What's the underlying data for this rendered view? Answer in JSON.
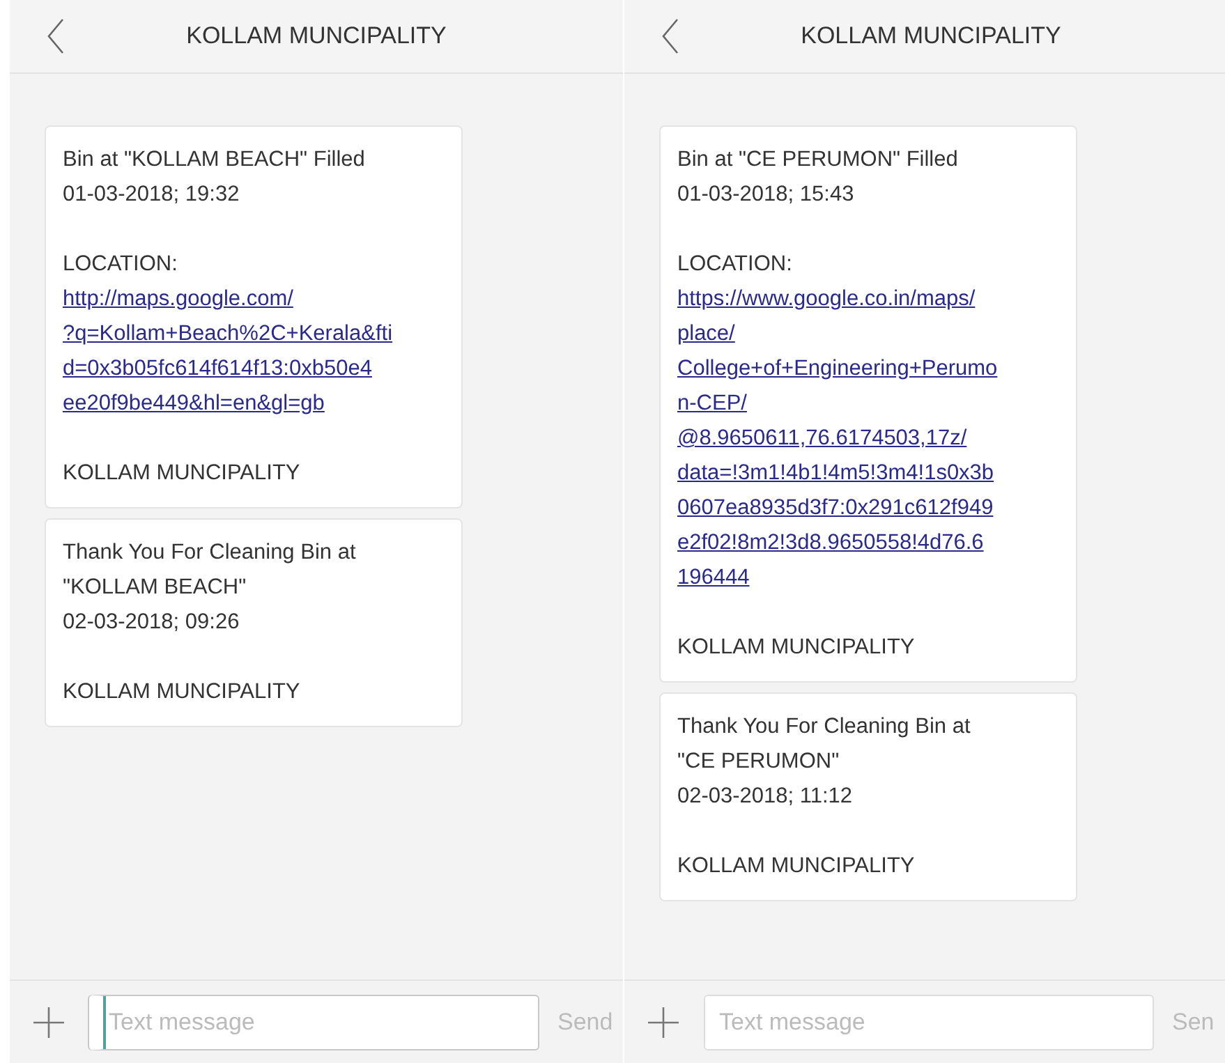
{
  "screens": [
    {
      "title": "KOLLAM MUNCIPALITY",
      "messages": [
        {
          "blocks": [
            {
              "kind": "text",
              "lines": [
                "Bin at \"KOLLAM BEACH\" Filled",
                "01-03-2018; 19:32"
              ]
            },
            {
              "kind": "location",
              "label": "LOCATION:",
              "lines": [
                "http://maps.google.com/",
                "?q=Kollam+Beach%2C+Kerala&fti",
                "d=0x3b05fc614f614f13:0xb50e4",
                "ee20f9be449&hl=en&gl=gb"
              ]
            },
            {
              "kind": "text",
              "lines": [
                "KOLLAM MUNCIPALITY"
              ]
            }
          ]
        },
        {
          "blocks": [
            {
              "kind": "text",
              "lines": [
                "Thank You For Cleaning Bin at",
                "\"KOLLAM BEACH\"",
                "02-03-2018; 09:26"
              ]
            },
            {
              "kind": "text",
              "lines": [
                "KOLLAM MUNCIPALITY"
              ]
            }
          ]
        }
      ],
      "input": {
        "placeholder": "Text message",
        "focused": true
      },
      "send": "Send"
    },
    {
      "title": "KOLLAM MUNCIPALITY",
      "messages": [
        {
          "blocks": [
            {
              "kind": "text",
              "lines": [
                "Bin at \"CE PERUMON\" Filled",
                "01-03-2018; 15:43"
              ]
            },
            {
              "kind": "location",
              "label": "LOCATION:",
              "lines": [
                "https://www.google.co.in/maps/",
                "place/",
                "College+of+Engineering+Perumo",
                "n-CEP/",
                "@8.9650611,76.6174503,17z/",
                "data=!3m1!4b1!4m5!3m4!1s0x3b",
                "0607ea8935d3f7:0x291c612f949",
                "e2f02!8m2!3d8.9650558!4d76.6",
                "196444"
              ]
            },
            {
              "kind": "text",
              "lines": [
                "KOLLAM MUNCIPALITY"
              ]
            }
          ]
        },
        {
          "blocks": [
            {
              "kind": "text",
              "lines": [
                "Thank You For Cleaning Bin at",
                "\"CE PERUMON\"",
                "02-03-2018; 11:12"
              ]
            },
            {
              "kind": "text",
              "lines": [
                "KOLLAM MUNCIPALITY"
              ]
            }
          ]
        }
      ],
      "input": {
        "placeholder": "Text message",
        "focused": false
      },
      "send": "Sen"
    }
  ]
}
